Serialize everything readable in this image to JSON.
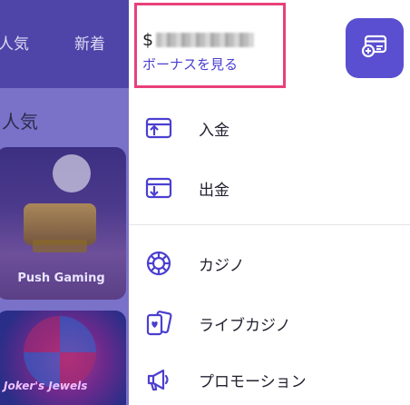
{
  "background": {
    "tabs": [
      "人気",
      "新着"
    ],
    "section_title": "人気",
    "card1_label": "Push Gaming",
    "card2_label": "Joker's Jewels"
  },
  "drawer": {
    "balance": {
      "currency": "$",
      "amount_masked": true,
      "bonus_link": "ボーナスを見る"
    },
    "wallet_button": {
      "icon": "wallet-card-icon"
    },
    "menu": [
      {
        "label": "入金",
        "icon": "deposit-icon"
      },
      {
        "label": "出金",
        "icon": "withdraw-icon"
      },
      {
        "label": "カジノ",
        "icon": "casino-chip-icon"
      },
      {
        "label": "ライブカジノ",
        "icon": "live-casino-cards-icon"
      },
      {
        "label": "プロモーション",
        "icon": "megaphone-icon"
      }
    ]
  },
  "colors": {
    "accent": "#5a4fd0",
    "link": "#4b3fd0",
    "highlight_border": "#e8407a",
    "overlay_bg": "#4f45a8"
  }
}
